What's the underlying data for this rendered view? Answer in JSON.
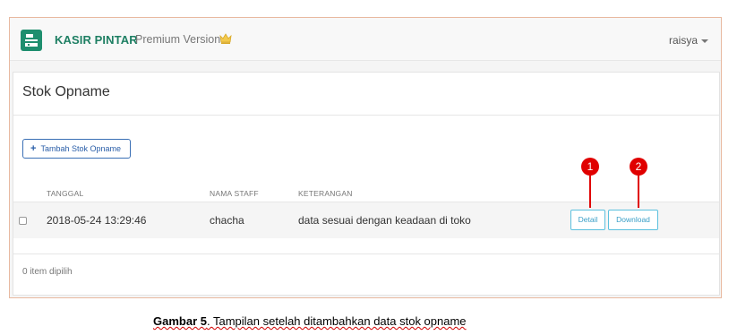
{
  "app": {
    "brand": "KASIR PINTAR",
    "version_label": "Premium Version",
    "crown_icon": "crown-icon",
    "user_name": "raisya",
    "accent_color": "#1e8e6e"
  },
  "page": {
    "title": "Stok Opname",
    "add_button_label": "Tambah Stok Opname",
    "add_button_icon": "+"
  },
  "table": {
    "columns": [
      "TANGGAL",
      "NAMA STAFF",
      "KETERANGAN"
    ],
    "rows": [
      {
        "tanggal": "2018-05-24 13:29:46",
        "nama_staff": "chacha",
        "keterangan": "data sesuai dengan keadaan di toko",
        "detail_label": "Detail",
        "download_label": "Download"
      }
    ],
    "selected_count_label": "0 item dipilih"
  },
  "callouts": [
    "1",
    "2"
  ],
  "caption": {
    "prefix": "Gambar 5",
    "text": ". Tampilan setelah ditambahkan data stok opname"
  }
}
